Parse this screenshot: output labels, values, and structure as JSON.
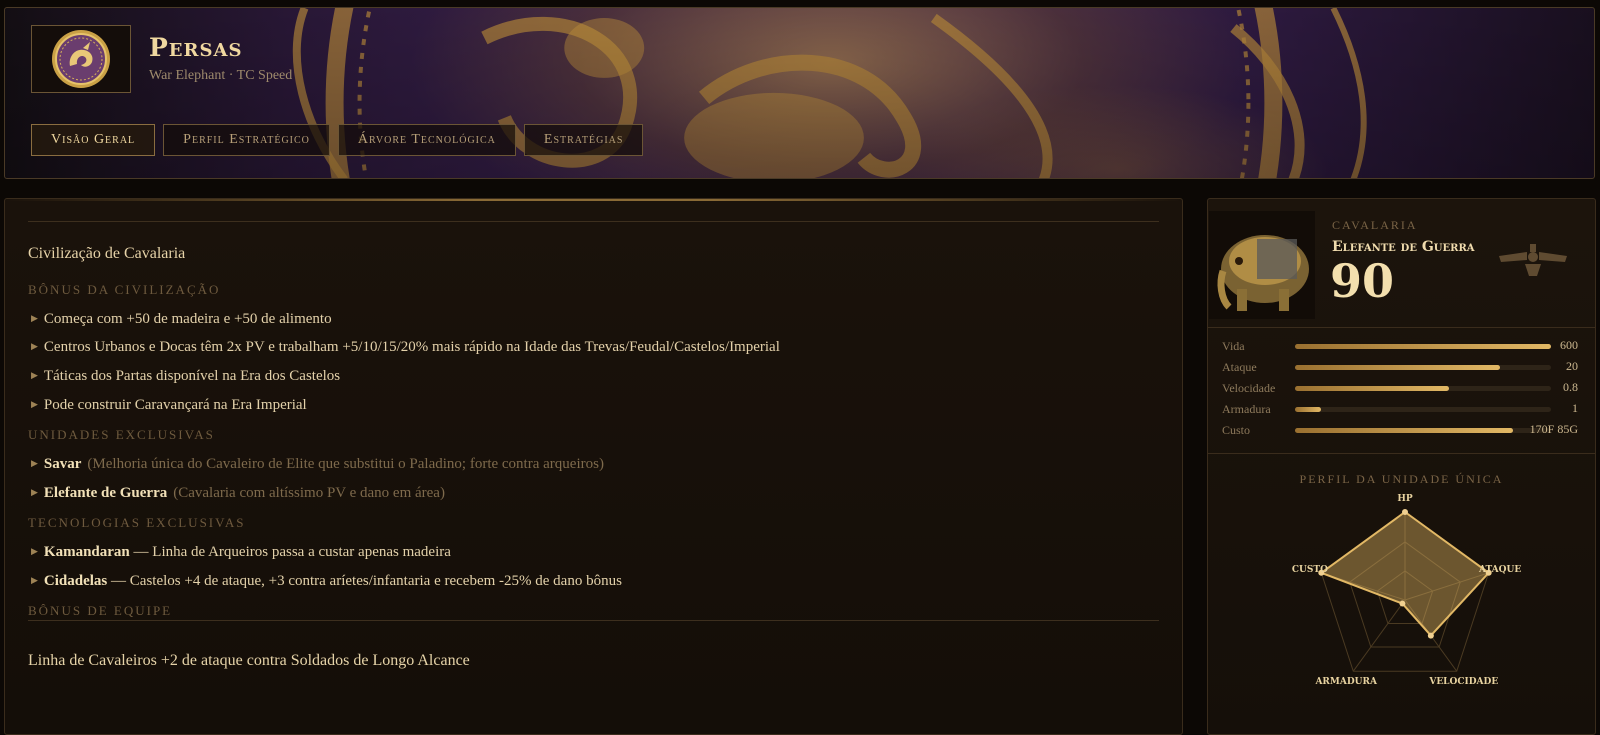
{
  "header": {
    "civ_name": "Persas",
    "subtitle": "War Elephant · TC Speed",
    "emblem_icon": "persian-griffin-emblem-icon"
  },
  "tabs": [
    {
      "label": "Visão Geral",
      "active": true
    },
    {
      "label": "Perfil Estratégico",
      "active": false
    },
    {
      "label": "Árvore Tecnológica",
      "active": false
    },
    {
      "label": "Estratégias",
      "active": false
    }
  ],
  "overview": {
    "title": "Civilização de Cavalaria",
    "sections": {
      "bonus_label": "Bônus da Civilização",
      "units_label": "Unidades Exclusivas",
      "techs_label": "Tecnologias Exclusivas",
      "team_label": "Bônus de Equipe"
    },
    "bonuses": [
      "Começa com +50 de madeira e +50 de alimento",
      "Centros Urbanos e Docas têm 2x PV e trabalham +5/10/15/20% mais rápido na Idade das Trevas/Feudal/Castelos/Imperial",
      "Táticas dos Partas disponível na Era dos Castelos",
      "Pode construir Caravançará na Era Imperial"
    ],
    "units": [
      {
        "name": "Savar",
        "note": "(Melhoria única do Cavaleiro de Elite que substitui o Paladino; forte contra arqueiros)"
      },
      {
        "name": "Elefante de Guerra",
        "note": "(Cavalaria com altíssimo PV e dano em área)"
      }
    ],
    "techs": [
      {
        "name": "Kamandaran",
        "desc": "— Linha de Arqueiros passa a custar apenas madeira"
      },
      {
        "name": "Cidadelas",
        "desc": "— Castelos +4 de ataque, +3 contra aríetes/infantaria e recebem -25% de dano bônus"
      }
    ],
    "team_bonus": "Linha de Cavaleiros +2 de ataque contra Soldados de Longo Alcance"
  },
  "unit_card": {
    "category": "Cavalaria",
    "name": "Elefante de Guerra",
    "score": "90",
    "image_icon": "war-elephant-portrait",
    "emblem_icon": "faravahar-icon",
    "stats": [
      {
        "label": "Vida",
        "value": "600",
        "fill": 1.0
      },
      {
        "label": "Ataque",
        "value": "20",
        "fill": 0.8
      },
      {
        "label": "Velocidade",
        "value": "0.8",
        "fill": 0.6
      },
      {
        "label": "Armadura",
        "value": "1",
        "fill": 0.1
      },
      {
        "label": "Custo",
        "value": "170F 85G",
        "fill": 0.85
      }
    ]
  },
  "profile": {
    "title": "Perfil da Unidade Única",
    "axes": [
      {
        "label": "HP",
        "value": 1.0
      },
      {
        "label": "Ataque",
        "value": 1.0
      },
      {
        "label": "Velocidade",
        "value": 0.5
      },
      {
        "label": "Armadura",
        "value": 0.05
      },
      {
        "label": "Custo",
        "value": 1.0
      }
    ],
    "accent": "#e2b865"
  },
  "colors": {
    "gold": "#e2b865",
    "header_purple": "#3a2150",
    "panel_bg": "#1a120b"
  }
}
